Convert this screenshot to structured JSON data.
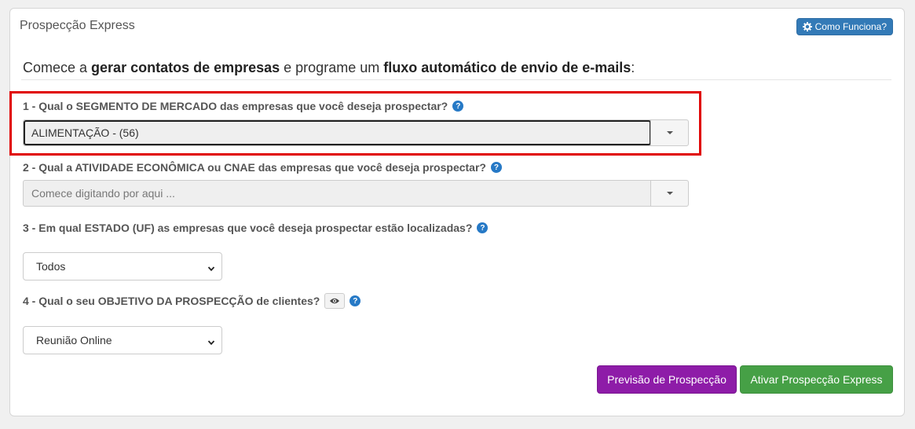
{
  "panel": {
    "title": "Prospecção Express",
    "help_button": "Como Funciona?",
    "help_icon": "gear-icon"
  },
  "intro": {
    "part1": "Comece a ",
    "bold1": "gerar contatos de empresas",
    "part2": " e programe um ",
    "bold2": "fluxo automático de envio de e-mails",
    "part3": ":"
  },
  "questions": {
    "q1": {
      "label": "1 - Qual o SEGMENTO DE MERCADO das empresas que você deseja prospectar?",
      "value": "ALIMENTAÇÃO - (56)"
    },
    "q2": {
      "label": "2 - Qual a ATIVIDADE ECONÔMICA ou CNAE das empresas que você deseja prospectar?",
      "placeholder": "Comece digitando por aqui ..."
    },
    "q3": {
      "label": "3 - Em qual ESTADO (UF) as empresas que você deseja prospectar estão localizadas?",
      "value": "Todos"
    },
    "q4": {
      "label": "4 - Qual o seu OBJETIVO DA PROSPECÇÃO de clientes?",
      "value": "Reunião Online"
    }
  },
  "help_mark": "?",
  "buttons": {
    "preview": "Previsão de Prospecção",
    "activate": "Ativar Prospecção Express"
  },
  "colors": {
    "primary": "#337ab7",
    "purple": "#8e1ca8",
    "green": "#46a046",
    "highlight": "#e00000"
  }
}
